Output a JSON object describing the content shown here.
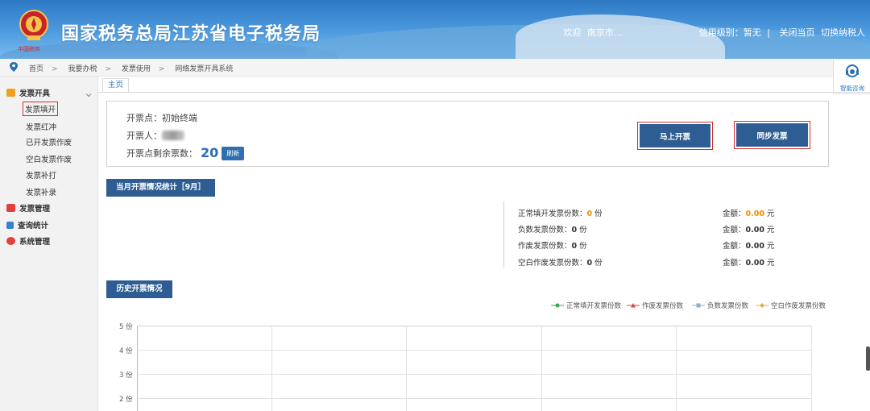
{
  "header": {
    "site_title": "国家税务总局江苏省电子税务局",
    "emblem_text": "中国税务",
    "welcome": "欢迎",
    "user": "南京市…",
    "credit_label": "信用级别：暂无",
    "close_page": "关闭当页",
    "switch_taxpayer": "切换纳税人"
  },
  "breadcrumb": [
    "首页",
    "我要办税",
    "发票使用",
    "网络发票开具系统"
  ],
  "breadcrumb_sep": ">",
  "helper": {
    "label": "智能咨询"
  },
  "sidebar": {
    "groups": [
      {
        "label": "发票开具",
        "icon": "edit-icon",
        "color": "#f0a020",
        "items": [
          "发票填开",
          "发票红冲",
          "已开发票作废",
          "空白发票作废",
          "发票补打",
          "发票补录"
        ]
      },
      {
        "label": "发票管理",
        "icon": "folder-icon",
        "color": "#e04040"
      },
      {
        "label": "查询统计",
        "icon": "bar-chart-icon",
        "color": "#3a7fd0"
      },
      {
        "label": "系统管理",
        "icon": "gear-icon",
        "color": "#e04040"
      }
    ]
  },
  "tab": {
    "label": "主页"
  },
  "issue_point": {
    "point_label": "开票点：",
    "point_value": "初始终端",
    "issuer_label": "开票人：",
    "remain_label": "开票点剩余票数：",
    "remain_count": "20",
    "refresh": "刷新"
  },
  "actions": {
    "issue_now": "马上开票",
    "sync": "同步发票"
  },
  "monthly": {
    "title": "当月开票情况统计［9月］",
    "rows": [
      {
        "label": "正常填开发票份数：",
        "count": "0",
        "amount": "0.00",
        "highlight": true
      },
      {
        "label": "负数发票份数：",
        "count": "0",
        "amount": "0.00",
        "highlight": false
      },
      {
        "label": "作废发票份数：",
        "count": "0",
        "amount": "0.00",
        "highlight": false
      },
      {
        "label": "空白作废发票份数：",
        "count": "0",
        "amount": "0.00",
        "highlight": false
      }
    ],
    "count_unit": "份",
    "amount_label": "金额：",
    "amount_unit": "元"
  },
  "history": {
    "title": "历史开票情况",
    "legend": [
      {
        "name": "正常填开发票份数",
        "color": "#3aa655",
        "marker": "circle"
      },
      {
        "name": "作废发票份数",
        "color": "#d84a4a",
        "marker": "triangle"
      },
      {
        "name": "负数发票份数",
        "color": "#8fb0c8",
        "marker": "square"
      },
      {
        "name": "空白作废发票份数",
        "color": "#e0b040",
        "marker": "diamond"
      }
    ]
  },
  "chart_data": {
    "type": "line",
    "title": "",
    "xlabel": "",
    "ylabel": "",
    "ylim": [
      1,
      5
    ],
    "y_ticks": [
      "5 份",
      "4 份",
      "3 份",
      "2 份"
    ],
    "grid": true,
    "legend_position": "top-right",
    "series": [
      {
        "name": "正常填开发票份数",
        "values": []
      },
      {
        "name": "作废发票份数",
        "values": []
      },
      {
        "name": "负数发票份数",
        "values": []
      },
      {
        "name": "空白作废发票份数",
        "values": []
      }
    ]
  }
}
